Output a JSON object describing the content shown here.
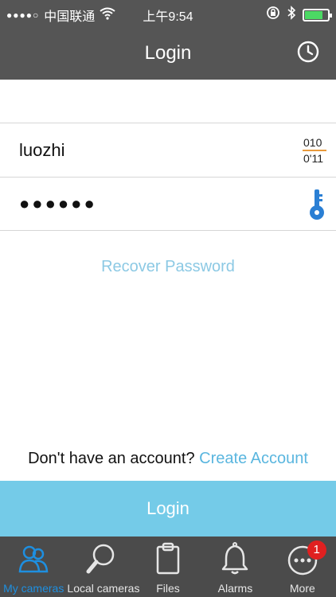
{
  "status_bar": {
    "signal": "●●●●○",
    "carrier": "中国联通",
    "time": "上午9:54"
  },
  "nav": {
    "title": "Login",
    "history_icon": "clock-icon"
  },
  "form": {
    "username": "luozhi",
    "password_mask": "●●●●●●",
    "scan_icon": "barcode-scan-icon",
    "key_icon": "key-icon"
  },
  "recover": {
    "label": "Recover Password"
  },
  "signup": {
    "prompt": "Don't have an account?",
    "link": "Create Account"
  },
  "login_button": {
    "label": "Login"
  },
  "tabs": [
    {
      "label": "My cameras",
      "icon": "users-icon",
      "active": true
    },
    {
      "label": "Local cameras",
      "icon": "search-icon",
      "active": false
    },
    {
      "label": "Files",
      "icon": "clipboard-icon",
      "active": false
    },
    {
      "label": "Alarms",
      "icon": "bell-icon",
      "active": false
    },
    {
      "label": "More",
      "icon": "more-icon",
      "active": false,
      "badge": "1"
    }
  ],
  "colors": {
    "header": "#555555",
    "accent": "#74cbe8",
    "link": "#5ab6df",
    "tab_bar": "#4b4b4b",
    "tab_active": "#1e8fe0"
  }
}
